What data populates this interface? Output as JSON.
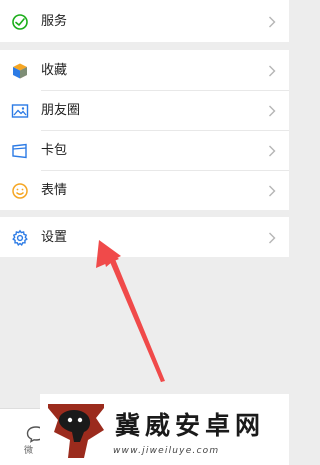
{
  "menu": {
    "services": {
      "label": "服务",
      "icon": "wechat-pay-icon",
      "color": "#1aad19"
    },
    "favorites": {
      "label": "收藏",
      "icon": "cube-icon"
    },
    "moments": {
      "label": "朋友圈",
      "icon": "picture-icon",
      "color": "#2c7be5"
    },
    "cards": {
      "label": "卡包",
      "icon": "card-wallet-icon",
      "color": "#2c7be5"
    },
    "stickers": {
      "label": "表情",
      "icon": "smiley-icon",
      "color": "#f5a623"
    },
    "settings": {
      "label": "设置",
      "icon": "gear-icon",
      "color": "#2c7be5"
    }
  },
  "tabbar": {
    "partial_label": "微"
  },
  "watermark": {
    "title": "冀威安卓网",
    "url": "www.jiweiluye.com"
  },
  "annotation": {
    "arrow_color": "#f04a4a"
  }
}
